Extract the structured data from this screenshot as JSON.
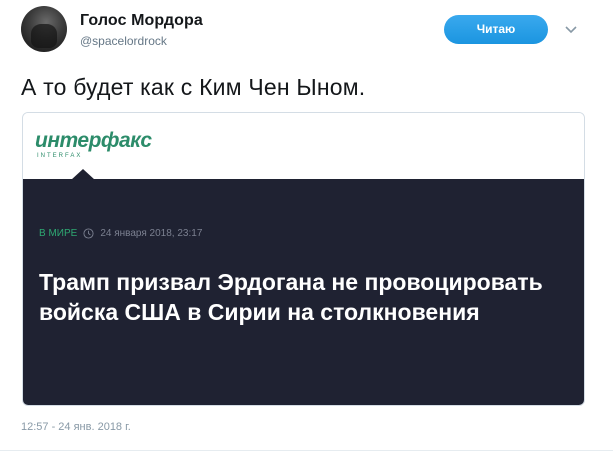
{
  "author": {
    "display_name": "Голос Мордора",
    "handle": "@spacelordrock"
  },
  "follow_button": {
    "label": "Читаю"
  },
  "tweet": {
    "text": "А то будет как с Ким Чен Ыном.",
    "timestamp": "12:57 - 24 янв. 2018 г."
  },
  "card": {
    "logo_text": "интерфакс",
    "logo_subtext": "INTERFAX",
    "section": "В МИРЕ",
    "date": "24 января 2018, 23:17",
    "headline": "Трамп призвал Эрдогана не провоцировать войска США в Сирии на столкновения"
  },
  "colors": {
    "follow_button": "#1da1f2",
    "card_background": "#1f2232",
    "logo_green": "#2c8c6a",
    "section_green": "#2ea872"
  },
  "icons": {
    "caret": "chevron-down-icon",
    "clock": "clock-icon"
  }
}
